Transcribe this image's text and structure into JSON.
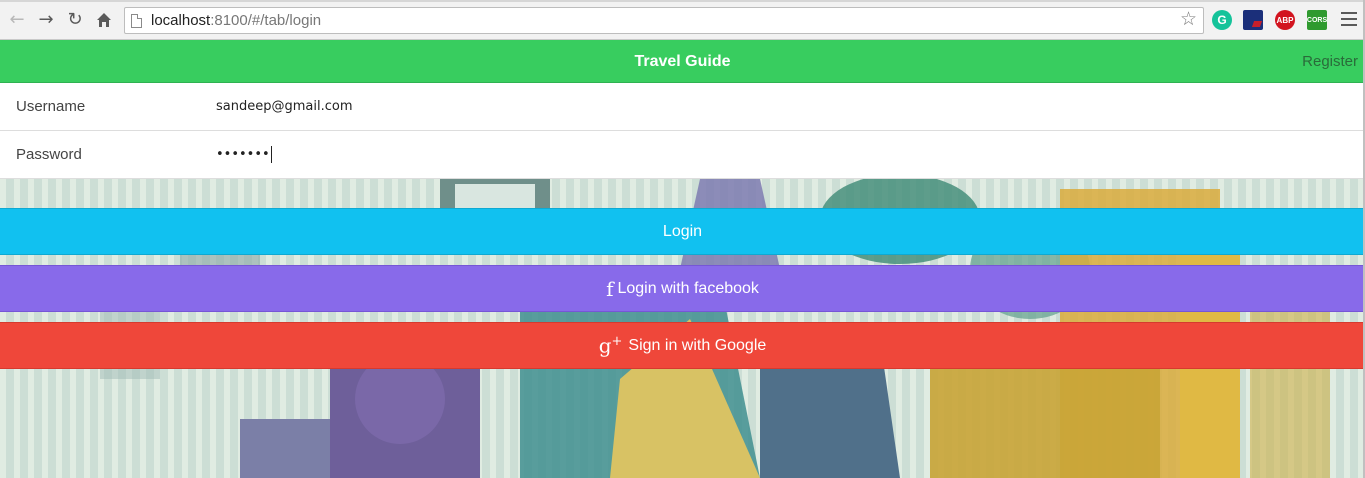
{
  "browser": {
    "url_host": "localhost",
    "url_rest": ":8100/#/tab/login",
    "nav": {
      "back_icon": "back-arrow-icon",
      "forward_icon": "forward-arrow-icon",
      "reload_icon": "reload-icon",
      "home_icon": "home-icon"
    },
    "extensions": [
      {
        "name": "grammarly-extension-icon",
        "label": "G"
      },
      {
        "name": "flag-extension-icon",
        "label": ""
      },
      {
        "name": "adblock-plus-extension-icon",
        "label": "ABP"
      },
      {
        "name": "cors-extension-icon",
        "label": "CORS"
      }
    ]
  },
  "header": {
    "title": "Travel Guide",
    "register_label": "Register",
    "color": "#38cd5f"
  },
  "form": {
    "username_label": "Username",
    "username_value": "sandeep@gmail.com",
    "password_label": "Password",
    "password_value": "•••••••"
  },
  "buttons": {
    "login_label": "Login",
    "facebook_label": "Login with facebook",
    "facebook_icon": "facebook-icon",
    "google_label": "Sign in with Google",
    "google_icon": "google-plus-icon",
    "colors": {
      "login": "#11c1f0",
      "facebook": "#886aea",
      "google": "#ef473a"
    }
  }
}
